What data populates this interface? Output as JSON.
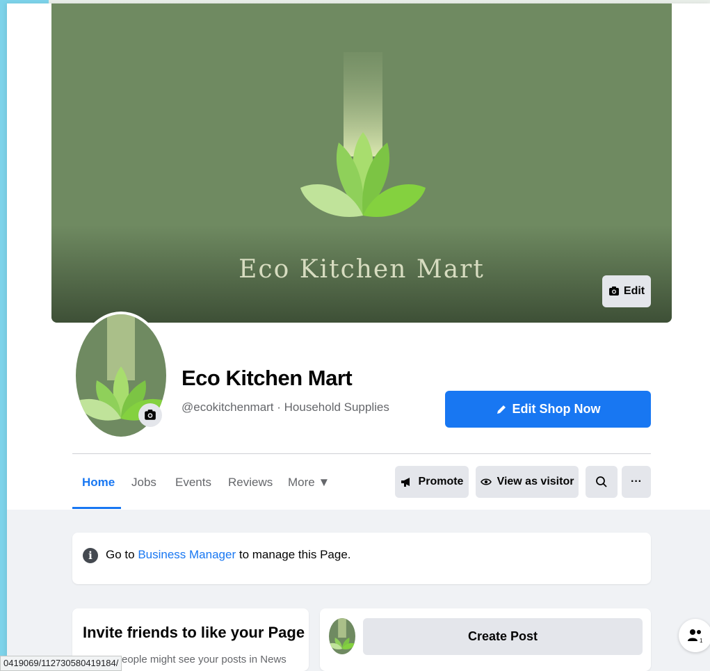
{
  "cover": {
    "brand_text": "Eco Kitchen Mart",
    "edit_label": "Edit"
  },
  "profile": {
    "name": "Eco Kitchen Mart",
    "subtitle": "@ecokitchenmart · Household Supplies",
    "cta_label": "Edit Shop Now"
  },
  "tabs": [
    {
      "label": "Home",
      "active": true
    },
    {
      "label": "Jobs"
    },
    {
      "label": "Events"
    },
    {
      "label": "Reviews"
    },
    {
      "label": "More ▼"
    }
  ],
  "actions": {
    "promote": "Promote",
    "view_as_visitor": "View as visitor",
    "more": "···"
  },
  "notice": {
    "prefix": "Go to ",
    "link": "Business Manager",
    "suffix": " to manage this Page."
  },
  "invite": {
    "title": "Invite friends to like your Page",
    "description": "eople might see your posts in News"
  },
  "composer": {
    "button_label": "Create Post"
  },
  "status_url": "0419069/112730580419184/",
  "colors": {
    "accent": "#1877f2",
    "cover_green": "#6f8a61",
    "leaf_light": "#b6e08a",
    "leaf_dark": "#8ccf4d"
  }
}
